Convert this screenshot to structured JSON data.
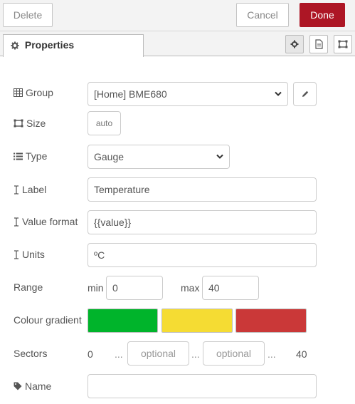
{
  "toolbar": {
    "delete_label": "Delete",
    "cancel_label": "Cancel",
    "done_label": "Done",
    "done_color": "#ad1625"
  },
  "tabs": {
    "properties_label": "Properties"
  },
  "form": {
    "group": {
      "label": "Group",
      "value": "[Home] BME680",
      "icon": "table-icon"
    },
    "size": {
      "label": "Size",
      "value": "auto",
      "icon": "resize-icon"
    },
    "type": {
      "label": "Type",
      "value": "Gauge",
      "icon": "list-icon"
    },
    "label": {
      "label": "Label",
      "value": "Temperature",
      "icon": "text-cursor-icon"
    },
    "value_format": {
      "label": "Value format",
      "value": "{{value}}",
      "icon": "text-cursor-icon"
    },
    "units": {
      "label": "Units",
      "value": "ºC",
      "icon": "text-cursor-icon"
    },
    "range": {
      "label": "Range",
      "min_label": "min",
      "min_value": "0",
      "max_label": "max",
      "max_value": "40"
    },
    "colour_gradient": {
      "label": "Colour gradient",
      "colors": [
        "#00b42b",
        "#f5dc33",
        "#ca3838"
      ]
    },
    "sectors": {
      "label": "Sectors",
      "start": "0",
      "end": "40",
      "separator": "...",
      "placeholder1": "optional",
      "placeholder2": "optional"
    },
    "name": {
      "label": "Name",
      "value": "",
      "icon": "tag-icon"
    }
  }
}
